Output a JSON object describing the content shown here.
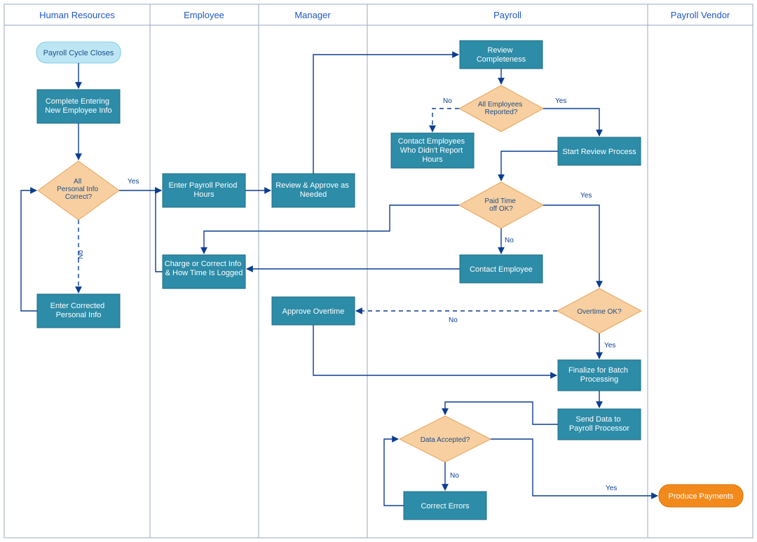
{
  "lanes": {
    "hr": "Human Resources",
    "employee": "Employee",
    "manager": "Manager",
    "payroll": "Payroll",
    "vendor": "Payroll Vendor"
  },
  "nodes": {
    "start": "Payroll Cycle Closes",
    "completeEntering": "Complete Entering New Employee Info",
    "allPersonalInfo": "All Personal Info Correct?",
    "enterCorrected": "Enter Corrected Personal Info",
    "enterPayrollHours": "Enter Payroll Period Hours",
    "chargeCorrect": "Charge or Correct Info & How Time Is Logged",
    "reviewApprove": "Review & Approve as Needed",
    "approveOvertime": "Approve Overtime",
    "reviewCompleteness": "Review Completeness",
    "allEmployeesReported": "All Employees Reported?",
    "contactNoReport": "Contact Employees Who Didn't Report Hours",
    "startReview": "Start Review Process",
    "paidTimeOffOK": "Paid Time off OK?",
    "contactEmployee": "Contact Employee",
    "overtimeOK": "Overtime OK?",
    "finalizeBatch": "Finalize for Batch Processing",
    "sendData": "Send Data to Payroll Processor",
    "dataAccepted": "Data Accepted?",
    "correctErrors": "Correct Errors",
    "producePayments": "Produce Payments"
  },
  "labels": {
    "yes": "Yes",
    "no": "No"
  }
}
